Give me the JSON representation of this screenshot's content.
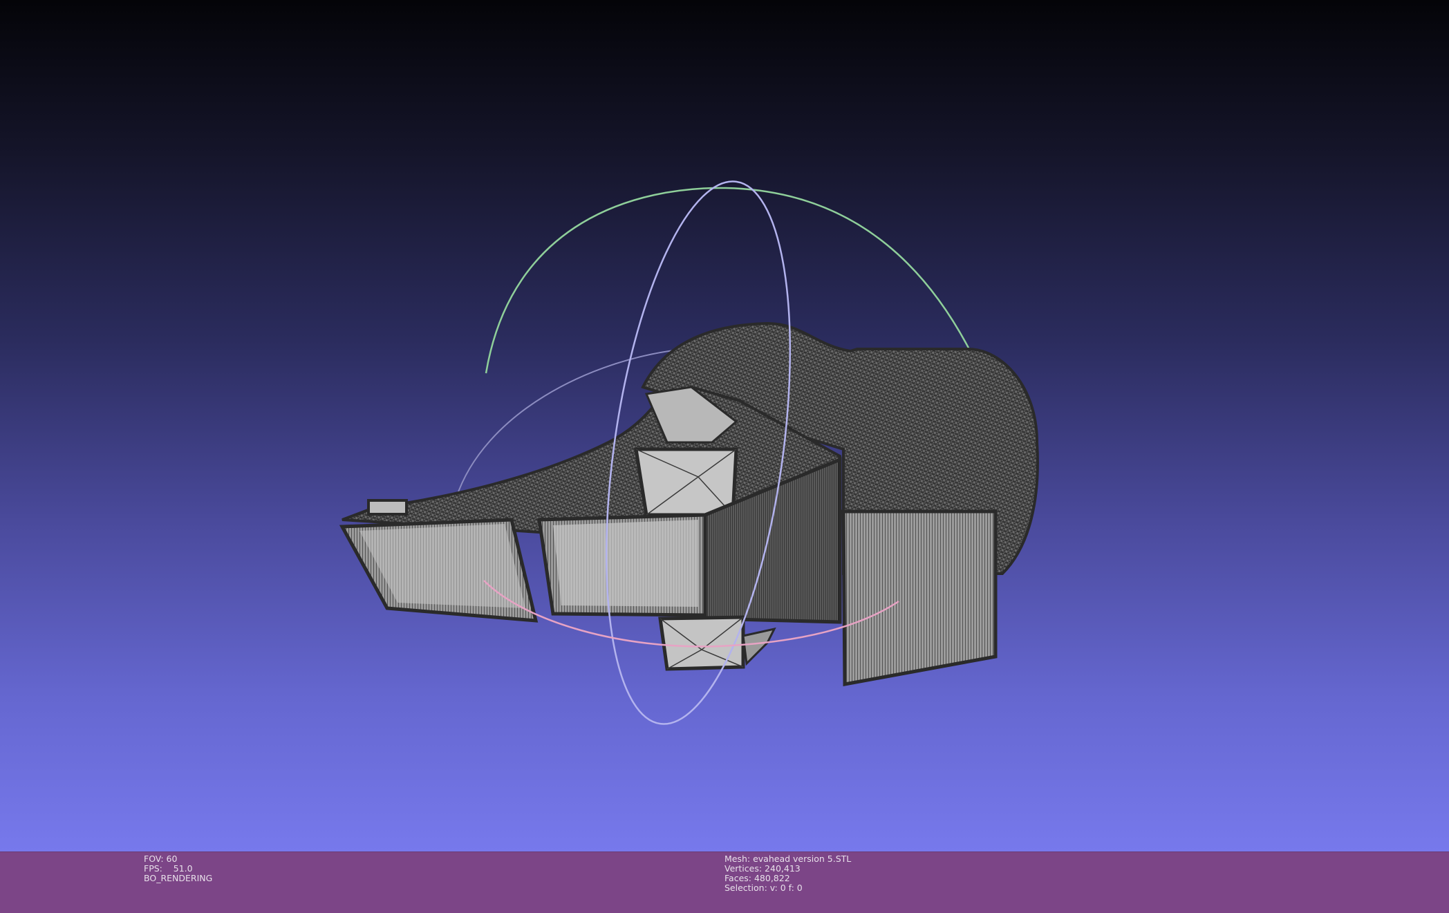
{
  "viewport": {
    "title": "3D mesh viewport",
    "background_top_color": "#040408",
    "background_bottom_color": "#7779ec",
    "mesh_fill_color": "#c4c4c4",
    "wire_color": "#3a3a3a",
    "trackball_colors": {
      "x_ring": "#9fd6a8",
      "y_ring": "#b9b9f0",
      "z_ring": "#e7a3c4"
    }
  },
  "status_bar": {
    "background_color": "#7c4587",
    "render_info": {
      "fov": "FOV: 60",
      "fps": "FPS:    51.0",
      "mode": "BO_RENDERING"
    },
    "mesh_info": {
      "mesh": "Mesh: evahead version 5.STL",
      "vertices": "Vertices: 240,413",
      "faces": "Faces: 480,822",
      "selection": "Selection: v: 0 f: 0"
    }
  }
}
